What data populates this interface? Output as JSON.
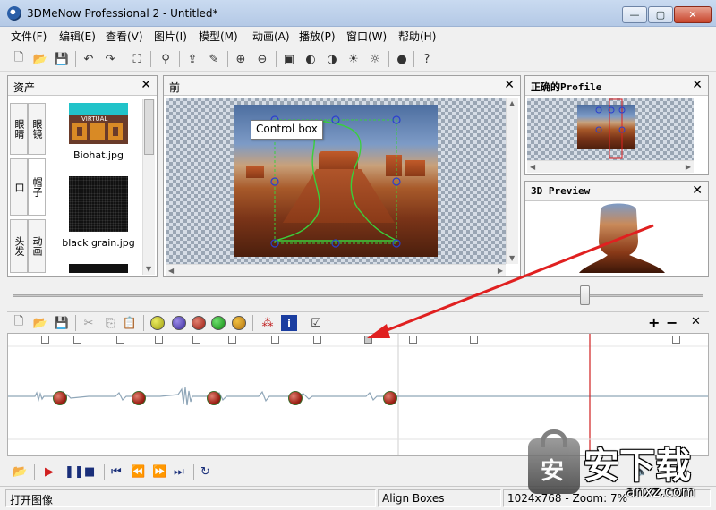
{
  "window": {
    "title": "3DMeNow Professional 2 - Untitled*",
    "min": "—",
    "max": "▢",
    "close": "✕"
  },
  "menu": [
    "文件(F)",
    "编辑(E)",
    "查看(V)",
    "图片(I)",
    "模型(M)",
    "动画(A)",
    "播放(P)",
    "窗口(W)",
    "帮助(H)"
  ],
  "assets": {
    "title": "资产",
    "tabs": [
      "眼睛",
      "眼镜",
      "口",
      "帽子",
      "头发",
      "动画"
    ],
    "items": [
      "Biohat.jpg",
      "black grain.jpg"
    ],
    "thumb_text": "VIRTUAL"
  },
  "front": {
    "title": "前",
    "tooltip": "Control box"
  },
  "profile": {
    "title": "正确的Profile"
  },
  "preview": {
    "title": "3D Preview"
  },
  "timeline": {
    "plus": "+",
    "minus": "−",
    "close": "✕"
  },
  "status": {
    "left": "打开图像",
    "mode": "Align Boxes",
    "zoom": "1024x768 - Zoom: 7%"
  },
  "watermark": {
    "text": "安下载",
    "sub": "anxz.com",
    "badge": "安"
  },
  "colors": {
    "accent_line": "#d02020",
    "waveform": "#8fa6b8",
    "control_box": "#3ad03a",
    "handles": "#2a3fd0"
  }
}
